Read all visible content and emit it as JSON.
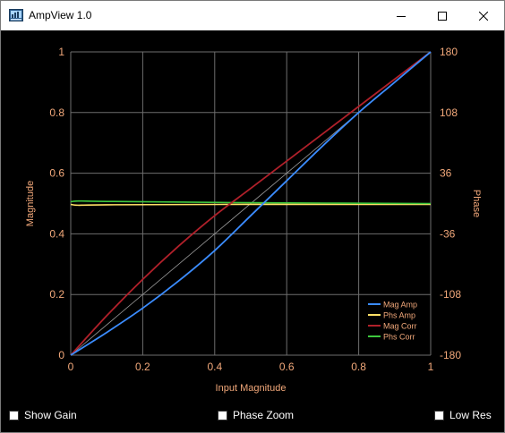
{
  "window": {
    "title": "AmpView 1.0"
  },
  "chart_data": {
    "type": "line",
    "xlabel": "Input Magnitude",
    "ylabel": "Magnitude",
    "y2label": "Phase",
    "xlim": [
      0,
      1
    ],
    "ylim": [
      0,
      1
    ],
    "y2lim": [
      -180,
      180
    ],
    "x_ticks": [
      "0",
      "0.2",
      "0.4",
      "0.6",
      "0.8",
      "1"
    ],
    "y_ticks": [
      "0",
      "0.2",
      "0.4",
      "0.6",
      "0.8",
      "1"
    ],
    "y2_ticks": [
      "-180",
      "-108",
      "-36",
      "36",
      "108",
      "180"
    ],
    "grid": true,
    "legend_position": "bottom-right",
    "colors": {
      "background": "#000000",
      "grid": "#6e6e6e",
      "axis_text": "#f2a87a",
      "reference": "#9a9a9a"
    },
    "series": [
      {
        "name": "Mag Amp",
        "color": "#3b8cff",
        "axis": "left",
        "x": [
          0,
          0.1,
          0.2,
          0.3,
          0.4,
          0.5,
          0.6,
          0.7,
          0.8,
          0.9,
          1.0
        ],
        "y": [
          0,
          0.075,
          0.155,
          0.245,
          0.345,
          0.46,
          0.575,
          0.69,
          0.8,
          0.9,
          1.0
        ]
      },
      {
        "name": "Phs Amp",
        "color": "#ffe066",
        "axis": "right",
        "x": [
          0,
          0.02,
          0.1,
          0.5,
          1.0
        ],
        "y": [
          -1,
          -2,
          -1.5,
          -1,
          -1
        ]
      },
      {
        "name": "Mag Corr",
        "color": "#b0202a",
        "axis": "left",
        "x": [
          0,
          0.1,
          0.2,
          0.3,
          0.4,
          0.5,
          0.6,
          0.7,
          0.8,
          0.9,
          1.0
        ],
        "y": [
          0,
          0.13,
          0.25,
          0.36,
          0.46,
          0.55,
          0.64,
          0.73,
          0.82,
          0.91,
          1.0
        ]
      },
      {
        "name": "Phs Corr",
        "color": "#3ec83e",
        "axis": "right",
        "x": [
          0,
          0.02,
          0.1,
          0.5,
          1.0
        ],
        "y": [
          2,
          3,
          2.5,
          1,
          0
        ]
      }
    ],
    "reference_line": {
      "x": [
        0,
        1
      ],
      "y": [
        0,
        1
      ]
    }
  },
  "controls": {
    "show_gain_label": "Show Gain",
    "phase_zoom_label": "Phase Zoom",
    "low_res_label": "Low Res"
  }
}
